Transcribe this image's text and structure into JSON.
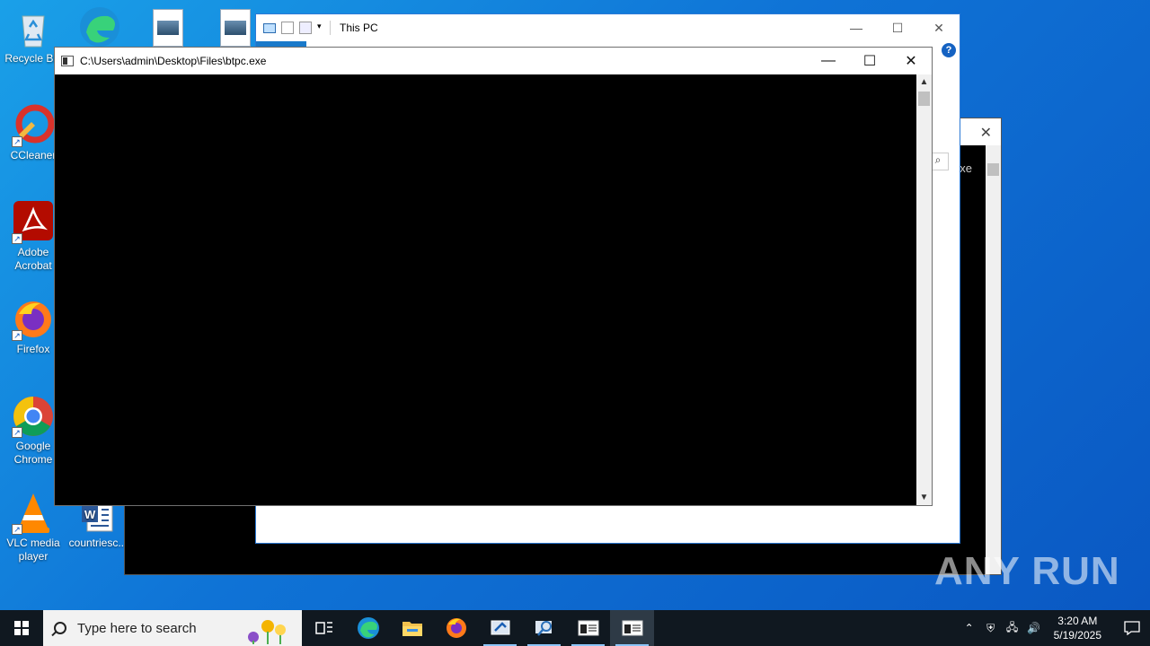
{
  "desktop": {
    "icons": [
      {
        "label": "Recycle Bin",
        "icon": "recycle-bin-icon"
      },
      {
        "label": "CCleaner",
        "icon": "ccleaner-icon"
      },
      {
        "label": "Adobe Acrobat",
        "icon": "adobe-acrobat-icon"
      },
      {
        "label": "Firefox",
        "icon": "firefox-icon"
      },
      {
        "label": "Google Chrome",
        "icon": "chrome-icon"
      },
      {
        "label": "VLC media player",
        "icon": "vlc-icon"
      },
      {
        "label": "countriesc...",
        "icon": "word-document-icon"
      }
    ]
  },
  "explorer": {
    "title": "This PC",
    "help": "?"
  },
  "back_console": {
    "fragment": "xe"
  },
  "console": {
    "title": "C:\\Users\\admin\\Desktop\\Files\\btpc.exe",
    "minimize": "—",
    "maximize": "☐",
    "close": "✕"
  },
  "watermark": "ANY RUN",
  "taskbar": {
    "search_placeholder": "Type here to search",
    "apps": [
      "task-view-icon",
      "edge-icon",
      "file-explorer-icon",
      "firefox-icon",
      "app-installer-icon",
      "search-tool-icon",
      "console-window-icon",
      "console-window-icon"
    ],
    "clock_time": "3:20 AM",
    "clock_date": "5/19/2025"
  },
  "colors": {
    "desktop_bg": "#0f73d6",
    "taskbar_bg": "#101820",
    "console_bg": "#000000"
  }
}
